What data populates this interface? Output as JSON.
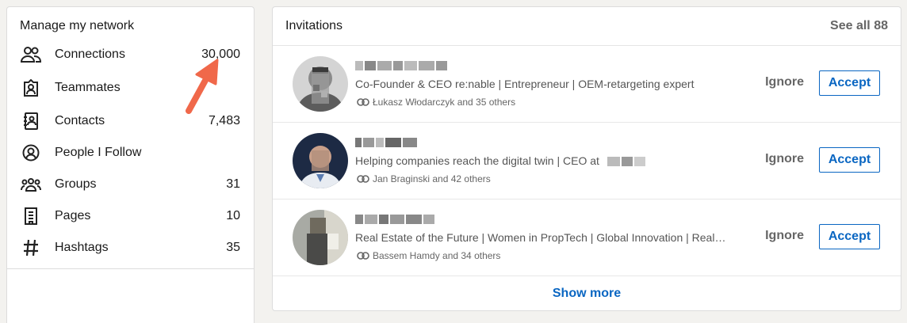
{
  "left": {
    "title": "Manage my network",
    "items": [
      {
        "label": "Connections",
        "count": "30,000",
        "icon": "connections-icon"
      },
      {
        "label": "Teammates",
        "count": "",
        "icon": "teammates-icon"
      },
      {
        "label": "Contacts",
        "count": "7,483",
        "icon": "contacts-icon"
      },
      {
        "label": "People I Follow",
        "count": "",
        "icon": "people-follow-icon"
      },
      {
        "label": "Groups",
        "count": "31",
        "icon": "groups-icon"
      },
      {
        "label": "Pages",
        "count": "10",
        "icon": "pages-icon"
      },
      {
        "label": "Hashtags",
        "count": "35",
        "icon": "hashtag-icon"
      }
    ]
  },
  "invitations": {
    "title": "Invitations",
    "see_all": "See all 88",
    "show_more": "Show more",
    "ignore_label": "Ignore",
    "accept_label": "Accept",
    "rows": [
      {
        "headline": "Co-Founder & CEO re:nable | Entrepreneur | OEM-retargeting expert",
        "mutual": "Łukasz Włodarczyk and 35 others"
      },
      {
        "headline": "Helping companies reach the digital twin | CEO at",
        "mutual": "Jan Braginski and 42 others"
      },
      {
        "headline": "Real Estate of the Future | Women in PropTech | Global Innovation | Real…",
        "mutual": "Bassem Hamdy and 34 others"
      }
    ]
  },
  "colors": {
    "accent": "#0a66c2",
    "annotation_arrow": "#f0684a"
  }
}
